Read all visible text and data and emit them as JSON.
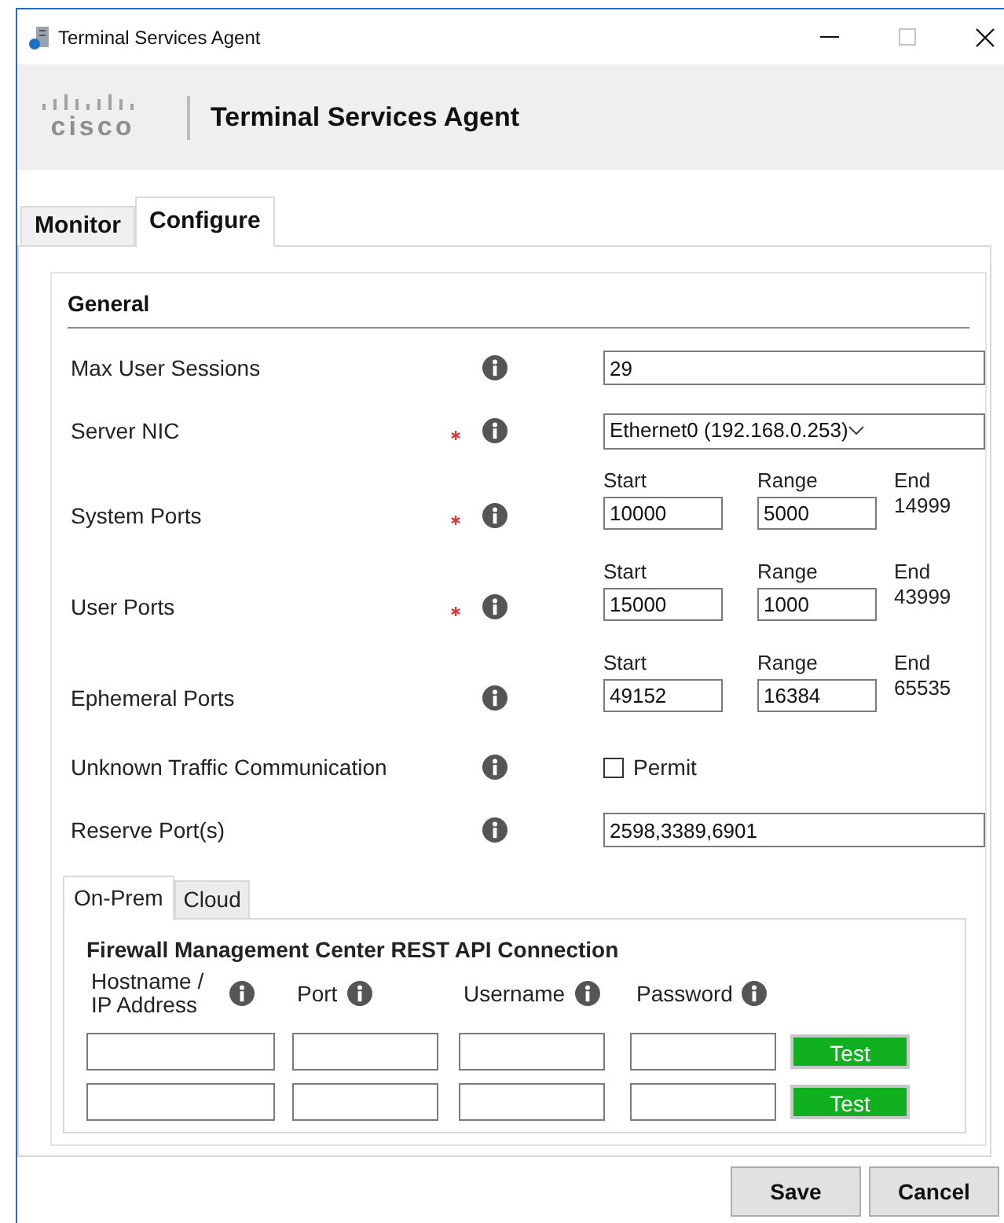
{
  "window": {
    "title": "Terminal Services Agent"
  },
  "banner": {
    "logo": "cisco",
    "title": "Terminal Services Agent"
  },
  "tabs": [
    {
      "label": "Monitor",
      "selected": false
    },
    {
      "label": "Configure",
      "selected": true
    }
  ],
  "general": {
    "title": "General",
    "fields": [
      {
        "kind": "text",
        "label": "Max User Sessions",
        "required": false,
        "value": "29"
      },
      {
        "kind": "select",
        "label": "Server NIC",
        "required": true,
        "value": "Ethernet0 (192.168.0.253)"
      },
      {
        "kind": "range",
        "label": "System Ports",
        "required": true,
        "start_label": "Start",
        "range_label": "Range",
        "end_label": "End",
        "start": "10000",
        "range": "5000",
        "end": "14999"
      },
      {
        "kind": "range",
        "label": "User Ports",
        "required": true,
        "start_label": "Start",
        "range_label": "Range",
        "end_label": "End",
        "start": "15000",
        "range": "1000",
        "end": "43999"
      },
      {
        "kind": "range",
        "label": "Ephemeral Ports",
        "required": false,
        "start_label": "Start",
        "range_label": "Range",
        "end_label": "End",
        "start": "49152",
        "range": "16384",
        "end": "65535"
      },
      {
        "kind": "checkbox",
        "label": "Unknown Traffic Communication",
        "required": false,
        "option": "Permit",
        "checked": false
      },
      {
        "kind": "text",
        "label": "Reserve Port(s)",
        "required": false,
        "value": "2598,3389,6901"
      }
    ]
  },
  "sub_tabs": [
    {
      "label": "On-Prem",
      "selected": true
    },
    {
      "label": "Cloud",
      "selected": false
    }
  ],
  "fmc": {
    "title": "Firewall Management Center REST API Connection",
    "columns": [
      "Hostname / IP Address",
      "Port",
      "Username",
      "Password"
    ],
    "rows": [
      {
        "button": "Test"
      },
      {
        "button": "Test"
      }
    ]
  },
  "buttons": [
    "Save",
    "Cancel"
  ]
}
